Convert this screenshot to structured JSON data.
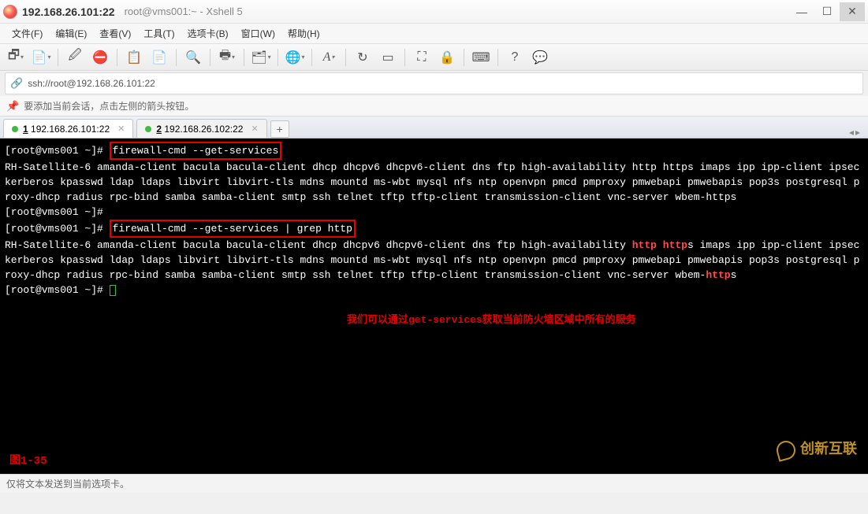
{
  "title": {
    "ip": "192.168.26.101:22",
    "sub": "root@vms001:~ - Xshell 5"
  },
  "menu": {
    "file": "文件(F)",
    "edit": "编辑(E)",
    "view": "查看(V)",
    "tools": "工具(T)",
    "tabs": "选项卡(B)",
    "window": "窗口(W)",
    "help": "帮助(H)"
  },
  "addr": {
    "url": "ssh://root@192.168.26.101:22"
  },
  "hint": {
    "text": "要添加当前会话，点击左侧的箭头按钮。"
  },
  "tabs": {
    "t1_num": "1",
    "t1_label": " 192.168.26.101:22",
    "t2_num": "2",
    "t2_label": " 192.168.26.102:22",
    "add": "+"
  },
  "term": {
    "prompt": "[root@vms001 ~]# ",
    "cmd1": "firewall-cmd --get-services",
    "out1": "RH-Satellite-6 amanda-client bacula bacula-client dhcp dhcpv6 dhcpv6-client dns ftp high-availability http https imaps ipp ipp-client ipsec kerberos kpasswd ldap ldaps libvirt libvirt-tls mdns mountd ms-wbt mysql nfs ntp openvpn pmcd pmproxy pmwebapi pmwebapis pop3s postgresql proxy-dhcp radius rpc-bind samba samba-client smtp ssh telnet tftp tftp-client transmission-client vnc-server wbem-https",
    "cmd2": "firewall-cmd --get-services | grep http",
    "out2_pre1": "RH-Satellite-6 amanda-client bacula bacula-client dhcp dhcpv6 dhcpv6-client dns ftp high-availability ",
    "out2_h1": "http",
    "out2_sp": " ",
    "out2_h2": "http",
    "out2_post1": "s imaps ipp ipp-client ipsec kerberos kpasswd ldap ldaps libvirt libvirt-tls mdns mountd ms-wbt mysql nfs ntp openvpn pmcd pmproxy pmwebapi pmwebapis pop3s postgresql proxy-dhcp radius rpc-bind samba samba-client smtp ssh telnet tftp tftp-client transmission-client vnc-server wbem-",
    "out2_h3": "http",
    "out2_post2": "s",
    "anno": "我们可以通过get-services获取当前防火墙区域中所有的服务",
    "figlabel": "图1-35"
  },
  "status": {
    "text": "仅将文本发送到当前选项卡。"
  },
  "watermark": {
    "text": "创新互联"
  }
}
